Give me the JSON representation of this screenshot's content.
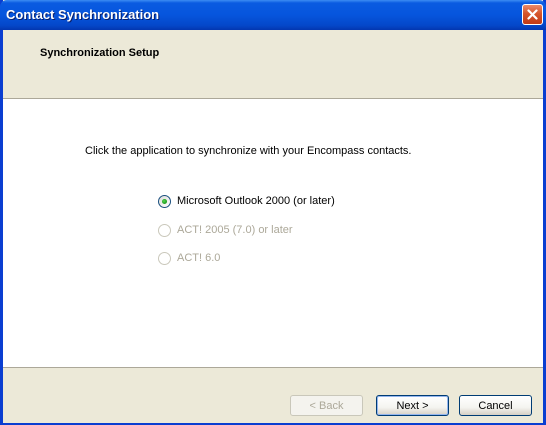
{
  "window": {
    "title": "Contact Synchronization",
    "close_icon": "close-icon"
  },
  "header": {
    "title": "Synchronization Setup"
  },
  "content": {
    "instruction": "Click the application to synchronize with your Encompass contacts.",
    "options": [
      {
        "label": "Microsoft Outlook 2000 (or later)",
        "selected": true,
        "enabled": true
      },
      {
        "label": "ACT! 2005 (7.0) or later",
        "selected": false,
        "enabled": false
      },
      {
        "label": "ACT! 6.0",
        "selected": false,
        "enabled": false
      }
    ]
  },
  "footer": {
    "back_label": "< Back",
    "next_label": "Next >",
    "cancel_label": "Cancel"
  },
  "colors": {
    "titlebar": "#0655dd",
    "dialog_bg": "#ece9d8",
    "radio_selected": "#21a121",
    "disabled_text": "#aca899"
  }
}
